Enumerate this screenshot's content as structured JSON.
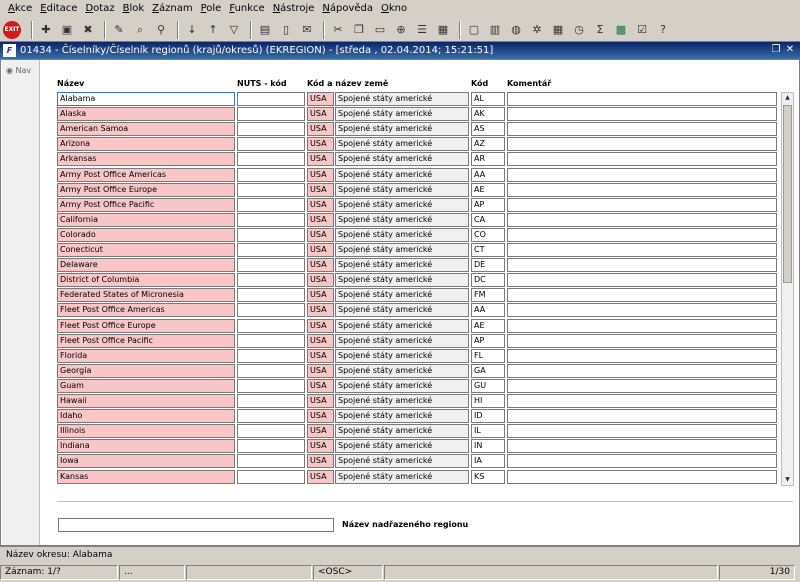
{
  "menu": [
    "Akce",
    "Editace",
    "Dotaz",
    "Blok",
    "Záznam",
    "Pole",
    "Funkce",
    "Nástroje",
    "Nápověda",
    "Okno"
  ],
  "toolbar": {
    "exit_label": "EXIT",
    "icons": [
      "new-record-icon",
      "save-icon",
      "delete-icon",
      "edit-icon",
      "query-enter-icon",
      "query-execute-icon",
      "sort-asc-icon",
      "sort-desc-icon",
      "filter-icon",
      "print-icon",
      "document-icon",
      "mail-icon",
      "cut-icon",
      "copy-icon",
      "paste-icon",
      "zoom-icon",
      "list-icon",
      "folder-icon",
      "calendar-icon",
      "globe-icon",
      "gear-icon",
      "calculator-icon",
      "clock-icon",
      "sum-icon",
      "excel-icon",
      "checkbox-icon",
      "help-icon"
    ]
  },
  "window": {
    "app_icon": "F",
    "title": "01434 - Číselníky/Číselník regionů (krajů/okresů) (EKREGION) - [středa , 02.04.2014; 15:21:51]"
  },
  "nav_label": "Nav",
  "columns": {
    "name": "Název",
    "nuts": "NUTS - kód",
    "country": "Kód a název země",
    "code": "Kód",
    "comment": "Komentář"
  },
  "rows": [
    {
      "name": "Alabama",
      "country_code": "USA",
      "country_name": "Spojené státy americké",
      "code": "AL"
    },
    {
      "name": "Alaska",
      "country_code": "USA",
      "country_name": "Spojené státy americké",
      "code": "AK"
    },
    {
      "name": "American Samoa",
      "country_code": "USA",
      "country_name": "Spojené státy americké",
      "code": "AS"
    },
    {
      "name": "Arizona",
      "country_code": "USA",
      "country_name": "Spojené státy americké",
      "code": "AZ"
    },
    {
      "name": "Arkansas",
      "country_code": "USA",
      "country_name": "Spojené státy americké",
      "code": "AR"
    },
    {
      "name": "Army Post Office Americas",
      "country_code": "USA",
      "country_name": "Spojené státy americké",
      "code": "AA"
    },
    {
      "name": "Army Post Office Europe",
      "country_code": "USA",
      "country_name": "Spojené státy americké",
      "code": "AE"
    },
    {
      "name": "Army Post Office Pacific",
      "country_code": "USA",
      "country_name": "Spojené státy americké",
      "code": "AP"
    },
    {
      "name": "California",
      "country_code": "USA",
      "country_name": "Spojené státy americké",
      "code": "CA"
    },
    {
      "name": "Colorado",
      "country_code": "USA",
      "country_name": "Spojené státy americké",
      "code": "CO"
    },
    {
      "name": "Conecticut",
      "country_code": "USA",
      "country_name": "Spojené státy americké",
      "code": "CT"
    },
    {
      "name": "Delaware",
      "country_code": "USA",
      "country_name": "Spojené státy americké",
      "code": "DE"
    },
    {
      "name": "District of Columbia",
      "country_code": "USA",
      "country_name": "Spojené státy americké",
      "code": "DC"
    },
    {
      "name": "Federated States of Micronesia",
      "country_code": "USA",
      "country_name": "Spojené státy americké",
      "code": "FM"
    },
    {
      "name": "Fleet Post Office Americas",
      "country_code": "USA",
      "country_name": "Spojené státy americké",
      "code": "AA"
    },
    {
      "name": "Fleet Post Office Europe",
      "country_code": "USA",
      "country_name": "Spojené státy americké",
      "code": "AE"
    },
    {
      "name": "Fleet Post Office Pacific",
      "country_code": "USA",
      "country_name": "Spojené státy americké",
      "code": "AP"
    },
    {
      "name": "Florida",
      "country_code": "USA",
      "country_name": "Spojené státy americké",
      "code": "FL"
    },
    {
      "name": "Georgia",
      "country_code": "USA",
      "country_name": "Spojené státy americké",
      "code": "GA"
    },
    {
      "name": "Guam",
      "country_code": "USA",
      "country_name": "Spojené státy americké",
      "code": "GU"
    },
    {
      "name": "Hawaii",
      "country_code": "USA",
      "country_name": "Spojené státy americké",
      "code": "HI"
    },
    {
      "name": "Idaho",
      "country_code": "USA",
      "country_name": "Spojené státy americké",
      "code": "ID"
    },
    {
      "name": "Illinois",
      "country_code": "USA",
      "country_name": "Spojené státy americké",
      "code": "IL"
    },
    {
      "name": "Indiana",
      "country_code": "USA",
      "country_name": "Spojené státy americké",
      "code": "IN"
    },
    {
      "name": "Iowa",
      "country_code": "USA",
      "country_name": "Spojené státy americké",
      "code": "IA"
    },
    {
      "name": "Kansas",
      "country_code": "USA",
      "country_name": "Spojené státy americké",
      "code": "KS"
    }
  ],
  "parent_region_label": "Název nadřazeného regionu",
  "status": {
    "line1": "Název okresu: Alabama",
    "record": "Záznam: 1/?",
    "seg2": "...",
    "osc": "<OSC>",
    "page": "1/30"
  },
  "colors": {
    "required_field": "#f8c6c6",
    "title_bar": "#0a246a",
    "exit_button": "#d21a1a"
  }
}
